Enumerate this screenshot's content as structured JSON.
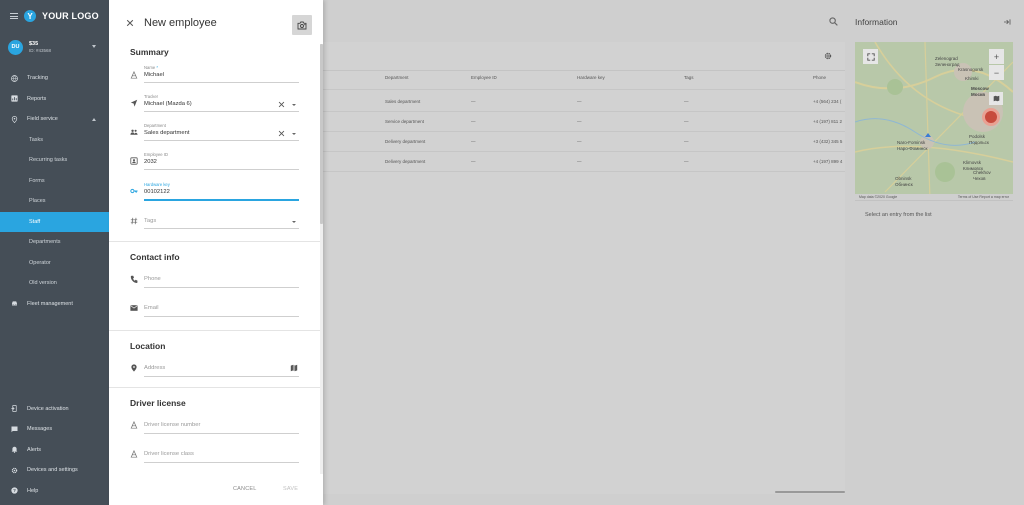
{
  "app": {
    "logo_letter": "Y",
    "logo_text": "YOUR LOGO"
  },
  "user": {
    "initials": "DU",
    "name": "$35",
    "id": "ID: #43568"
  },
  "sidebar": {
    "items": [
      {
        "label": "Tracking",
        "icon": "globe-icon"
      },
      {
        "label": "Reports",
        "icon": "chart-icon"
      },
      {
        "label": "Field service",
        "icon": "pin-icon"
      }
    ],
    "field_service_sub": [
      {
        "label": "Tasks"
      },
      {
        "label": "Recurring tasks"
      },
      {
        "label": "Forms"
      },
      {
        "label": "Places"
      },
      {
        "label": "Staff",
        "active": true
      },
      {
        "label": "Departments"
      },
      {
        "label": "Operator"
      },
      {
        "label": "Old version"
      }
    ],
    "fleet": {
      "label": "Fleet management",
      "icon": "car-icon"
    },
    "bottom": [
      {
        "label": "Device activation",
        "icon": "device-icon"
      },
      {
        "label": "Messages",
        "icon": "message-icon"
      },
      {
        "label": "Alerts",
        "icon": "bell-icon"
      },
      {
        "label": "Devices and settings",
        "icon": "gear-icon"
      },
      {
        "label": "Help",
        "icon": "help-icon"
      }
    ]
  },
  "form": {
    "title": "New employee",
    "summary": {
      "title": "Summary",
      "name_label": "Name",
      "name_required": "*",
      "name_value": "Michael",
      "tracker_label": "Tracker",
      "tracker_value": "Michael (Mazda 6)",
      "department_label": "Department",
      "department_value": "Sales department",
      "employee_id_label": "Employee ID",
      "employee_id_value": "2032",
      "hardware_key_label": "Hardware key",
      "hardware_key_value": "00102122",
      "tags_placeholder": "Tags"
    },
    "contact": {
      "title": "Contact info",
      "phone_placeholder": "Phone",
      "email_placeholder": "Email"
    },
    "location": {
      "title": "Location",
      "address_placeholder": "Address"
    },
    "license": {
      "title": "Driver license",
      "number_placeholder": "Driver license number",
      "class_placeholder": "Driver license class"
    },
    "cancel_label": "CANCEL",
    "save_label": "SAVE"
  },
  "list": {
    "headers": {
      "department": "Department",
      "employee_id": "Employee ID",
      "hardware_key": "Hardware key",
      "tags": "Tags",
      "phone": "Phone"
    },
    "rows": [
      {
        "department": "Sales department",
        "employee_id": "—",
        "hardware_key": "—",
        "tags": "—",
        "phone": "+4 (564) 234 ("
      },
      {
        "department": "Service department",
        "employee_id": "—",
        "hardware_key": "—",
        "tags": "—",
        "phone": "+4 (197) 811 2"
      },
      {
        "department": "Delivery department",
        "employee_id": "—",
        "hardware_key": "—",
        "tags": "—",
        "phone": "+3 (432) 345 5"
      },
      {
        "department": "Delivery department",
        "employee_id": "—",
        "hardware_key": "—",
        "tags": "—",
        "phone": "+4 (197) 899 4"
      }
    ]
  },
  "info": {
    "title": "Information",
    "empty_text": "Select an entry from the list",
    "map": {
      "zoom_in": "+",
      "zoom_out": "−",
      "labels": [
        "Zelenograd",
        "Зеленоград",
        "Krasnogorsk",
        "Khimki",
        "Moscow",
        "Москв",
        "Naro-Fominsk",
        "Наро-Фоминск",
        "Podolsk",
        "Подольск",
        "Chekhov",
        "Чехов",
        "Obninsk",
        "Обнинск",
        "Klimovsk",
        "Климовск"
      ],
      "footer_left": "Map data ©2020 Google",
      "footer_right": "Terms of Use   Report a map error"
    }
  },
  "colors": {
    "accent": "#2aa5e0",
    "sidebar_bg": "#454e57",
    "marker": "#c74b3d"
  }
}
